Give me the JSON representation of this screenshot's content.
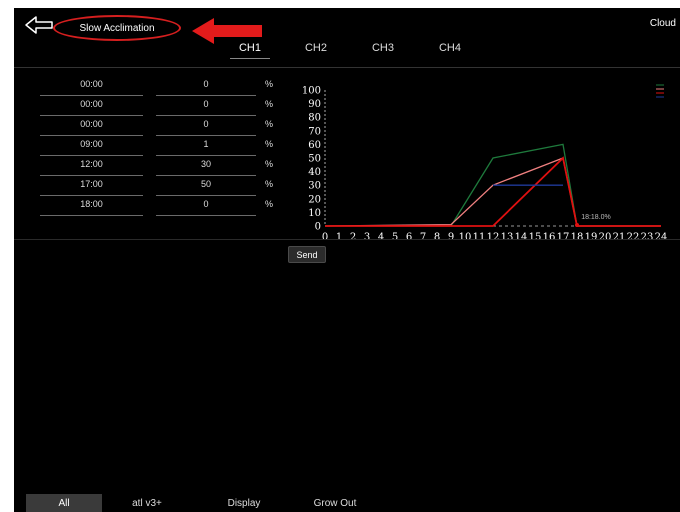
{
  "header": {
    "title": "Slow Acclimation",
    "right_label": "Cloud"
  },
  "tabs": [
    {
      "label": "CH1"
    },
    {
      "label": "CH2"
    },
    {
      "label": "CH3"
    },
    {
      "label": "CH4"
    }
  ],
  "active_tab": 0,
  "schedule": [
    {
      "time": "00:00",
      "value": "0",
      "unit": "%"
    },
    {
      "time": "00:00",
      "value": "0",
      "unit": "%"
    },
    {
      "time": "00:00",
      "value": "0",
      "unit": "%"
    },
    {
      "time": "09:00",
      "value": "1",
      "unit": "%"
    },
    {
      "time": "12:00",
      "value": "30",
      "unit": "%"
    },
    {
      "time": "17:00",
      "value": "50",
      "unit": "%"
    },
    {
      "time": "18:00",
      "value": "0",
      "unit": "%"
    }
  ],
  "send_label": "Send",
  "bottom_tabs": [
    {
      "label": "All"
    },
    {
      "label": "atl v3+"
    },
    {
      "label": "Display"
    },
    {
      "label": "Grow Out"
    }
  ],
  "active_bottom_tab": 0,
  "colors": {
    "background": "#000000",
    "annotation_red": "#d61f1f",
    "series_green": "#1e7a3c",
    "series_pink": "#f08080",
    "series_red": "#e01010",
    "series_blue": "#1f3a9a"
  },
  "chart_data": {
    "type": "line",
    "x_ticks": [
      0,
      1,
      2,
      3,
      4,
      5,
      6,
      7,
      8,
      9,
      10,
      11,
      12,
      13,
      14,
      15,
      16,
      17,
      18,
      19,
      20,
      21,
      22,
      23,
      24
    ],
    "y_ticks": [
      0,
      10,
      20,
      30,
      40,
      50,
      60,
      70,
      80,
      90,
      100
    ],
    "xlim": [
      0,
      24
    ],
    "ylim": [
      0,
      100
    ],
    "annotation": "18:18.0%",
    "series": [
      {
        "color": "#1e7a3c",
        "x": [
          0,
          8,
          9,
          12,
          17,
          18,
          24
        ],
        "y": [
          0,
          0,
          0,
          50,
          60,
          0,
          0
        ]
      },
      {
        "color": "#f08080",
        "x": [
          0,
          9,
          12,
          17,
          18,
          24
        ],
        "y": [
          0,
          1,
          30,
          50,
          0,
          0
        ]
      },
      {
        "color": "#e01010",
        "x": [
          0,
          9,
          12,
          17,
          18,
          24
        ],
        "y": [
          0,
          0,
          0,
          50,
          0,
          0
        ]
      },
      {
        "color": "#1f3a9a",
        "x": [
          12,
          17
        ],
        "y": [
          30,
          30
        ]
      }
    ]
  }
}
